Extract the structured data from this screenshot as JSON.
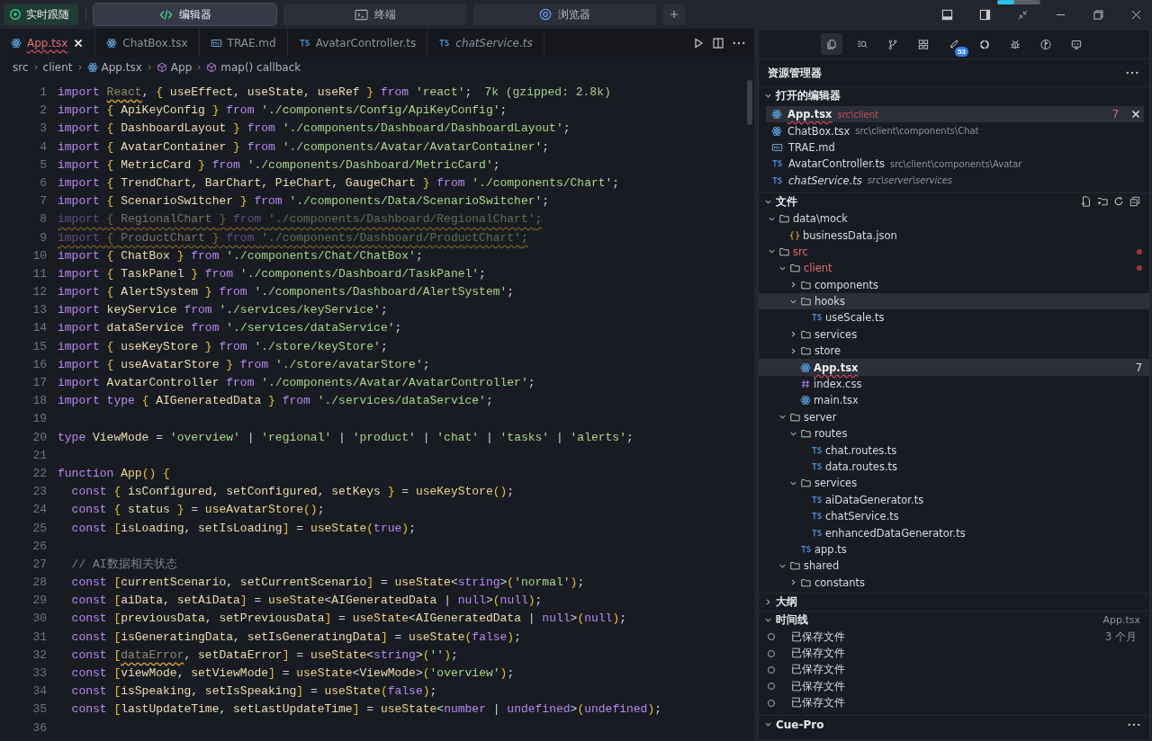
{
  "follow_button": {
    "label": "实时跟随"
  },
  "mode_tabs": [
    {
      "label": "编辑器",
      "kind": "code",
      "selected": true
    },
    {
      "label": "终端",
      "kind": "terminal",
      "selected": false
    },
    {
      "label": "浏览器",
      "kind": "compass",
      "selected": false
    }
  ],
  "top_progress": {
    "level": 0.4
  },
  "editor": {
    "tabs": [
      {
        "label": "App.tsx",
        "kind": "react",
        "selected": true,
        "error": true,
        "preview": false
      },
      {
        "label": "ChatBox.tsx",
        "kind": "react",
        "selected": false,
        "error": false,
        "preview": false
      },
      {
        "label": "TRAE.md",
        "kind": "md",
        "selected": false,
        "error": false,
        "preview": false
      },
      {
        "label": "AvatarController.ts",
        "kind": "ts",
        "selected": false,
        "error": false,
        "preview": false
      },
      {
        "label": "chatService.ts",
        "kind": "ts",
        "selected": false,
        "error": false,
        "preview": true
      }
    ],
    "breadcrumb": [
      {
        "label": "src",
        "kind": "folder"
      },
      {
        "label": "client",
        "kind": "folder"
      },
      {
        "label": "App.tsx",
        "kind": "react"
      },
      {
        "label": "App",
        "kind": "symbol"
      },
      {
        "label": "map() callback",
        "kind": "symbol"
      }
    ],
    "lines": [
      {
        "number": "1",
        "indented": false,
        "unused": false,
        "tokens": [
          {
            "kind": "keyword",
            "text": "import "
          },
          {
            "kind": "unused",
            "text": "React"
          },
          {
            "kind": "plain",
            "text": ", "
          },
          {
            "kind": "brace",
            "text": "{ "
          },
          {
            "kind": "name",
            "text": "useEffect, useState, useRef "
          },
          {
            "kind": "brace",
            "text": "}"
          },
          {
            "kind": "keyword",
            "text": " from "
          },
          {
            "kind": "string",
            "text": "'react'"
          },
          {
            "kind": "plain",
            "text": ";"
          }
        ],
        "hint": "7k (gzipped: 2.8k)"
      },
      {
        "number": "2",
        "indented": false,
        "unused": false,
        "tokens": [
          {
            "kind": "keyword",
            "text": "import "
          },
          {
            "kind": "brace",
            "text": "{ "
          },
          {
            "kind": "name",
            "text": "ApiKeyConfig "
          },
          {
            "kind": "brace",
            "text": "}"
          },
          {
            "kind": "keyword",
            "text": " from "
          },
          {
            "kind": "string",
            "text": "'./components/Config/ApiKeyConfig'"
          },
          {
            "kind": "plain",
            "text": ";"
          }
        ]
      },
      {
        "number": "3",
        "indented": false,
        "unused": false,
        "tokens": [
          {
            "kind": "keyword",
            "text": "import "
          },
          {
            "kind": "brace",
            "text": "{ "
          },
          {
            "kind": "name",
            "text": "DashboardLayout "
          },
          {
            "kind": "brace",
            "text": "}"
          },
          {
            "kind": "keyword",
            "text": " from "
          },
          {
            "kind": "string",
            "text": "'./components/Dashboard/DashboardLayout'"
          },
          {
            "kind": "plain",
            "text": ";"
          }
        ]
      },
      {
        "number": "4",
        "indented": false,
        "unused": false,
        "tokens": [
          {
            "kind": "keyword",
            "text": "import "
          },
          {
            "kind": "brace",
            "text": "{ "
          },
          {
            "kind": "name",
            "text": "AvatarContainer "
          },
          {
            "kind": "brace",
            "text": "}"
          },
          {
            "kind": "keyword",
            "text": " from "
          },
          {
            "kind": "string",
            "text": "'./components/Avatar/AvatarContainer'"
          },
          {
            "kind": "plain",
            "text": ";"
          }
        ]
      },
      {
        "number": "5",
        "indented": false,
        "unused": false,
        "tokens": [
          {
            "kind": "keyword",
            "text": "import "
          },
          {
            "kind": "brace",
            "text": "{ "
          },
          {
            "kind": "name",
            "text": "MetricCard "
          },
          {
            "kind": "brace",
            "text": "}"
          },
          {
            "kind": "keyword",
            "text": " from "
          },
          {
            "kind": "string",
            "text": "'./components/Dashboard/MetricCard'"
          },
          {
            "kind": "plain",
            "text": ";"
          }
        ]
      },
      {
        "number": "6",
        "indented": false,
        "unused": false,
        "tokens": [
          {
            "kind": "keyword",
            "text": "import "
          },
          {
            "kind": "brace",
            "text": "{ "
          },
          {
            "kind": "name",
            "text": "TrendChart, BarChart, PieChart, GaugeChart "
          },
          {
            "kind": "brace",
            "text": "}"
          },
          {
            "kind": "keyword",
            "text": " from "
          },
          {
            "kind": "string",
            "text": "'./components/Chart'"
          },
          {
            "kind": "plain",
            "text": ";"
          }
        ]
      },
      {
        "number": "7",
        "indented": false,
        "unused": false,
        "tokens": [
          {
            "kind": "keyword",
            "text": "import "
          },
          {
            "kind": "brace",
            "text": "{ "
          },
          {
            "kind": "name",
            "text": "ScenarioSwitcher "
          },
          {
            "kind": "brace",
            "text": "}"
          },
          {
            "kind": "keyword",
            "text": " from "
          },
          {
            "kind": "string",
            "text": "'./components/Data/ScenarioSwitcher'"
          },
          {
            "kind": "plain",
            "text": ";"
          }
        ]
      },
      {
        "number": "8",
        "indented": false,
        "unused": true,
        "tokens": [
          {
            "kind": "keyword",
            "text": "import "
          },
          {
            "kind": "brace",
            "text": "{ "
          },
          {
            "kind": "name",
            "text": "RegionalChart "
          },
          {
            "kind": "brace",
            "text": "}"
          },
          {
            "kind": "keyword",
            "text": " from "
          },
          {
            "kind": "string",
            "text": "'./components/Dashboard/RegionalChart'"
          },
          {
            "kind": "plain",
            "text": ";"
          }
        ]
      },
      {
        "number": "9",
        "indented": false,
        "unused": true,
        "tokens": [
          {
            "kind": "keyword",
            "text": "import "
          },
          {
            "kind": "brace",
            "text": "{ "
          },
          {
            "kind": "name",
            "text": "ProductChart "
          },
          {
            "kind": "brace",
            "text": "}"
          },
          {
            "kind": "keyword",
            "text": " from "
          },
          {
            "kind": "string",
            "text": "'./components/Dashboard/ProductChart'"
          },
          {
            "kind": "plain",
            "text": ";"
          }
        ]
      },
      {
        "number": "10",
        "indented": false,
        "unused": false,
        "tokens": [
          {
            "kind": "keyword",
            "text": "import "
          },
          {
            "kind": "brace",
            "text": "{ "
          },
          {
            "kind": "name",
            "text": "ChatBox "
          },
          {
            "kind": "brace",
            "text": "}"
          },
          {
            "kind": "keyword",
            "text": " from "
          },
          {
            "kind": "string",
            "text": "'./components/Chat/ChatBox'"
          },
          {
            "kind": "plain",
            "text": ";"
          }
        ]
      },
      {
        "number": "11",
        "indented": false,
        "unused": false,
        "tokens": [
          {
            "kind": "keyword",
            "text": "import "
          },
          {
            "kind": "brace",
            "text": "{ "
          },
          {
            "kind": "name",
            "text": "TaskPanel "
          },
          {
            "kind": "brace",
            "text": "}"
          },
          {
            "kind": "keyword",
            "text": " from "
          },
          {
            "kind": "string",
            "text": "'./components/Dashboard/TaskPanel'"
          },
          {
            "kind": "plain",
            "text": ";"
          }
        ]
      },
      {
        "number": "12",
        "indented": false,
        "unused": false,
        "tokens": [
          {
            "kind": "keyword",
            "text": "import "
          },
          {
            "kind": "brace",
            "text": "{ "
          },
          {
            "kind": "name",
            "text": "AlertSystem "
          },
          {
            "kind": "brace",
            "text": "}"
          },
          {
            "kind": "keyword",
            "text": " from "
          },
          {
            "kind": "string",
            "text": "'./components/Dashboard/AlertSystem'"
          },
          {
            "kind": "plain",
            "text": ";"
          }
        ]
      },
      {
        "number": "13",
        "indented": false,
        "unused": false,
        "tokens": [
          {
            "kind": "keyword",
            "text": "import "
          },
          {
            "kind": "name",
            "text": "keyService"
          },
          {
            "kind": "keyword",
            "text": " from "
          },
          {
            "kind": "string",
            "text": "'./services/keyService'"
          },
          {
            "kind": "plain",
            "text": ";"
          }
        ]
      },
      {
        "number": "14",
        "indented": false,
        "unused": false,
        "tokens": [
          {
            "kind": "keyword",
            "text": "import "
          },
          {
            "kind": "name",
            "text": "dataService"
          },
          {
            "kind": "keyword",
            "text": " from "
          },
          {
            "kind": "string",
            "text": "'./services/dataService'"
          },
          {
            "kind": "plain",
            "text": ";"
          }
        ]
      },
      {
        "number": "15",
        "indented": false,
        "unused": false,
        "tokens": [
          {
            "kind": "keyword",
            "text": "import "
          },
          {
            "kind": "brace",
            "text": "{ "
          },
          {
            "kind": "name",
            "text": "useKeyStore "
          },
          {
            "kind": "brace",
            "text": "}"
          },
          {
            "kind": "keyword",
            "text": " from "
          },
          {
            "kind": "string",
            "text": "'./store/keyStore'"
          },
          {
            "kind": "plain",
            "text": ";"
          }
        ]
      },
      {
        "number": "16",
        "indented": false,
        "unused": false,
        "tokens": [
          {
            "kind": "keyword",
            "text": "import "
          },
          {
            "kind": "brace",
            "text": "{ "
          },
          {
            "kind": "name",
            "text": "useAvatarStore "
          },
          {
            "kind": "brace",
            "text": "}"
          },
          {
            "kind": "keyword",
            "text": " from "
          },
          {
            "kind": "string",
            "text": "'./store/avatarStore'"
          },
          {
            "kind": "plain",
            "text": ";"
          }
        ]
      },
      {
        "number": "17",
        "indented": false,
        "unused": false,
        "tokens": [
          {
            "kind": "keyword",
            "text": "import "
          },
          {
            "kind": "name",
            "text": "AvatarController"
          },
          {
            "kind": "keyword",
            "text": " from "
          },
          {
            "kind": "string",
            "text": "'./components/Avatar/AvatarController'"
          },
          {
            "kind": "plain",
            "text": ";"
          }
        ]
      },
      {
        "number": "18",
        "indented": false,
        "unused": false,
        "tokens": [
          {
            "kind": "keyword",
            "text": "import type "
          },
          {
            "kind": "brace",
            "text": "{ "
          },
          {
            "kind": "name",
            "text": "AIGeneratedData "
          },
          {
            "kind": "brace",
            "text": "}"
          },
          {
            "kind": "keyword",
            "text": " from "
          },
          {
            "kind": "string",
            "text": "'./services/dataService'"
          },
          {
            "kind": "plain",
            "text": ";"
          }
        ]
      },
      {
        "number": "19"
      },
      {
        "number": "20",
        "indented": false,
        "unused": false,
        "tokens": [
          {
            "kind": "keyword",
            "text": "type "
          },
          {
            "kind": "name",
            "text": "ViewMode"
          },
          {
            "kind": "plain",
            "text": " = "
          },
          {
            "kind": "string",
            "text": "'overview'"
          },
          {
            "kind": "plain",
            "text": " | "
          },
          {
            "kind": "string",
            "text": "'regional'"
          },
          {
            "kind": "plain",
            "text": " | "
          },
          {
            "kind": "string",
            "text": "'product'"
          },
          {
            "kind": "plain",
            "text": " | "
          },
          {
            "kind": "string",
            "text": "'chat'"
          },
          {
            "kind": "plain",
            "text": " | "
          },
          {
            "kind": "string",
            "text": "'tasks'"
          },
          {
            "kind": "plain",
            "text": " | "
          },
          {
            "kind": "string",
            "text": "'alerts'"
          },
          {
            "kind": "plain",
            "text": ";"
          }
        ]
      },
      {
        "number": "21"
      },
      {
        "number": "22",
        "indented": false,
        "unused": false,
        "tokens": [
          {
            "kind": "keyword",
            "text": "function "
          },
          {
            "kind": "call",
            "text": "App"
          },
          {
            "kind": "brace",
            "text": "() {"
          }
        ]
      },
      {
        "number": "23",
        "indented": true,
        "unused": false,
        "tokens": [
          {
            "kind": "keyword",
            "text": "const "
          },
          {
            "kind": "brace",
            "text": "{ "
          },
          {
            "kind": "name",
            "text": "isConfigured, setConfigured, setKeys "
          },
          {
            "kind": "brace",
            "text": "}"
          },
          {
            "kind": "plain",
            "text": " = "
          },
          {
            "kind": "call",
            "text": "useKeyStore"
          },
          {
            "kind": "brace",
            "text": "()"
          },
          {
            "kind": "plain",
            "text": ";"
          }
        ]
      },
      {
        "number": "24",
        "indented": true,
        "unused": false,
        "tokens": [
          {
            "kind": "keyword",
            "text": "const "
          },
          {
            "kind": "brace",
            "text": "{ "
          },
          {
            "kind": "name",
            "text": "status "
          },
          {
            "kind": "brace",
            "text": "}"
          },
          {
            "kind": "plain",
            "text": " = "
          },
          {
            "kind": "call",
            "text": "useAvatarStore"
          },
          {
            "kind": "brace",
            "text": "()"
          },
          {
            "kind": "plain",
            "text": ";"
          }
        ]
      },
      {
        "number": "25",
        "indented": true,
        "unused": false,
        "tokens": [
          {
            "kind": "keyword",
            "text": "const "
          },
          {
            "kind": "brace",
            "text": "["
          },
          {
            "kind": "name",
            "text": "isLoading, setIsLoading"
          },
          {
            "kind": "brace",
            "text": "]"
          },
          {
            "kind": "plain",
            "text": " = "
          },
          {
            "kind": "call",
            "text": "useState"
          },
          {
            "kind": "brace",
            "text": "("
          },
          {
            "kind": "keyword",
            "text": "true"
          },
          {
            "kind": "brace",
            "text": ")"
          },
          {
            "kind": "plain",
            "text": ";"
          }
        ]
      },
      {
        "number": "26"
      },
      {
        "number": "27",
        "indented": true,
        "unused": false,
        "tokens": [
          {
            "kind": "comment",
            "text": "// AI数据相关状态"
          }
        ]
      },
      {
        "number": "28",
        "indented": true,
        "unused": false,
        "tokens": [
          {
            "kind": "keyword",
            "text": "const "
          },
          {
            "kind": "brace",
            "text": "["
          },
          {
            "kind": "name",
            "text": "currentScenario, setCurrentScenario"
          },
          {
            "kind": "brace",
            "text": "]"
          },
          {
            "kind": "plain",
            "text": " = "
          },
          {
            "kind": "call",
            "text": "useState"
          },
          {
            "kind": "plain",
            "text": "<"
          },
          {
            "kind": "keyword",
            "text": "string"
          },
          {
            "kind": "plain",
            "text": ">"
          },
          {
            "kind": "brace",
            "text": "("
          },
          {
            "kind": "string",
            "text": "'normal'"
          },
          {
            "kind": "brace",
            "text": ")"
          },
          {
            "kind": "plain",
            "text": ";"
          }
        ]
      },
      {
        "number": "29",
        "indented": true,
        "unused": false,
        "tokens": [
          {
            "kind": "keyword",
            "text": "const "
          },
          {
            "kind": "brace",
            "text": "["
          },
          {
            "kind": "name",
            "text": "aiData, setAiData"
          },
          {
            "kind": "brace",
            "text": "]"
          },
          {
            "kind": "plain",
            "text": " = "
          },
          {
            "kind": "call",
            "text": "useState"
          },
          {
            "kind": "plain",
            "text": "<"
          },
          {
            "kind": "name",
            "text": "AIGeneratedData"
          },
          {
            "kind": "plain",
            "text": " | "
          },
          {
            "kind": "keyword",
            "text": "null"
          },
          {
            "kind": "plain",
            "text": ">"
          },
          {
            "kind": "brace",
            "text": "("
          },
          {
            "kind": "keyword",
            "text": "null"
          },
          {
            "kind": "brace",
            "text": ")"
          },
          {
            "kind": "plain",
            "text": ";"
          }
        ]
      },
      {
        "number": "30",
        "indented": true,
        "unused": false,
        "tokens": [
          {
            "kind": "keyword",
            "text": "const "
          },
          {
            "kind": "brace",
            "text": "["
          },
          {
            "kind": "name",
            "text": "previousData, setPreviousData"
          },
          {
            "kind": "brace",
            "text": "]"
          },
          {
            "kind": "plain",
            "text": " = "
          },
          {
            "kind": "call",
            "text": "useState"
          },
          {
            "kind": "plain",
            "text": "<"
          },
          {
            "kind": "name",
            "text": "AIGeneratedData"
          },
          {
            "kind": "plain",
            "text": " | "
          },
          {
            "kind": "keyword",
            "text": "null"
          },
          {
            "kind": "plain",
            "text": ">"
          },
          {
            "kind": "brace",
            "text": "("
          },
          {
            "kind": "keyword",
            "text": "null"
          },
          {
            "kind": "brace",
            "text": ")"
          },
          {
            "kind": "plain",
            "text": ";"
          }
        ]
      },
      {
        "number": "31",
        "indented": true,
        "unused": false,
        "tokens": [
          {
            "kind": "keyword",
            "text": "const "
          },
          {
            "kind": "brace",
            "text": "["
          },
          {
            "kind": "name",
            "text": "isGeneratingData, setIsGeneratingData"
          },
          {
            "kind": "brace",
            "text": "]"
          },
          {
            "kind": "plain",
            "text": " = "
          },
          {
            "kind": "call",
            "text": "useState"
          },
          {
            "kind": "brace",
            "text": "("
          },
          {
            "kind": "keyword",
            "text": "false"
          },
          {
            "kind": "brace",
            "text": ")"
          },
          {
            "kind": "plain",
            "text": ";"
          }
        ]
      },
      {
        "number": "32",
        "indented": true,
        "unused": false,
        "tokens": [
          {
            "kind": "keyword",
            "text": "const "
          },
          {
            "kind": "brace",
            "text": "["
          },
          {
            "kind": "unused",
            "text": "dataError"
          },
          {
            "kind": "name",
            "text": ", setDataError"
          },
          {
            "kind": "brace",
            "text": "]"
          },
          {
            "kind": "plain",
            "text": " = "
          },
          {
            "kind": "call",
            "text": "useState"
          },
          {
            "kind": "plain",
            "text": "<"
          },
          {
            "kind": "keyword",
            "text": "string"
          },
          {
            "kind": "plain",
            "text": ">"
          },
          {
            "kind": "brace",
            "text": "("
          },
          {
            "kind": "string",
            "text": "''"
          },
          {
            "kind": "brace",
            "text": ")"
          },
          {
            "kind": "plain",
            "text": ";"
          }
        ]
      },
      {
        "number": "33",
        "indented": true,
        "unused": false,
        "tokens": [
          {
            "kind": "keyword",
            "text": "const "
          },
          {
            "kind": "brace",
            "text": "["
          },
          {
            "kind": "name",
            "text": "viewMode, setViewMode"
          },
          {
            "kind": "brace",
            "text": "]"
          },
          {
            "kind": "plain",
            "text": " = "
          },
          {
            "kind": "call",
            "text": "useState"
          },
          {
            "kind": "plain",
            "text": "<"
          },
          {
            "kind": "name",
            "text": "ViewMode"
          },
          {
            "kind": "plain",
            "text": ">"
          },
          {
            "kind": "brace",
            "text": "("
          },
          {
            "kind": "string",
            "text": "'overview'"
          },
          {
            "kind": "brace",
            "text": ")"
          },
          {
            "kind": "plain",
            "text": ";"
          }
        ]
      },
      {
        "number": "34",
        "indented": true,
        "unused": false,
        "tokens": [
          {
            "kind": "keyword",
            "text": "const "
          },
          {
            "kind": "brace",
            "text": "["
          },
          {
            "kind": "name",
            "text": "isSpeaking, setIsSpeaking"
          },
          {
            "kind": "brace",
            "text": "]"
          },
          {
            "kind": "plain",
            "text": " = "
          },
          {
            "kind": "call",
            "text": "useState"
          },
          {
            "kind": "brace",
            "text": "("
          },
          {
            "kind": "keyword",
            "text": "false"
          },
          {
            "kind": "brace",
            "text": ")"
          },
          {
            "kind": "plain",
            "text": ";"
          }
        ]
      },
      {
        "number": "35",
        "indented": true,
        "unused": false,
        "tokens": [
          {
            "kind": "keyword",
            "text": "const "
          },
          {
            "kind": "brace",
            "text": "["
          },
          {
            "kind": "name",
            "text": "lastUpdateTime, setLastUpdateTime"
          },
          {
            "kind": "brace",
            "text": "]"
          },
          {
            "kind": "plain",
            "text": " = "
          },
          {
            "kind": "call",
            "text": "useState"
          },
          {
            "kind": "plain",
            "text": "<"
          },
          {
            "kind": "keyword",
            "text": "number"
          },
          {
            "kind": "plain",
            "text": " | "
          },
          {
            "kind": "keyword",
            "text": "undefined"
          },
          {
            "kind": "plain",
            "text": ">"
          },
          {
            "kind": "brace",
            "text": "("
          },
          {
            "kind": "keyword",
            "text": "undefined"
          },
          {
            "kind": "brace",
            "text": ")"
          },
          {
            "kind": "plain",
            "text": ";"
          }
        ]
      },
      {
        "number": "36"
      }
    ]
  },
  "activity_bar": [
    {
      "kind": "files",
      "selected": true
    },
    {
      "kind": "search",
      "selected": false
    },
    {
      "kind": "branch",
      "selected": false
    },
    {
      "kind": "grid",
      "selected": false
    },
    {
      "kind": "rocket",
      "selected": false,
      "badge": "53"
    },
    {
      "kind": "ring",
      "selected": false
    },
    {
      "kind": "bug",
      "selected": false
    },
    {
      "kind": "flow",
      "selected": false
    },
    {
      "kind": "monitor",
      "selected": false
    }
  ],
  "explorer": {
    "title": "资源管理器",
    "open_editors": {
      "title": "打开的编辑器",
      "expanded": true,
      "items": [
        {
          "name": "App.tsx",
          "path": "src\\client",
          "kind": "react",
          "selected": true,
          "error": true,
          "preview": false,
          "count": "7"
        },
        {
          "name": "ChatBox.tsx",
          "path": "src\\client\\components\\Chat",
          "kind": "react",
          "selected": false,
          "error": false,
          "preview": false
        },
        {
          "name": "TRAE.md",
          "kind": "md",
          "selected": false,
          "error": false,
          "preview": false
        },
        {
          "name": "AvatarController.ts",
          "path": "src\\client\\components\\Avatar",
          "kind": "ts",
          "selected": false,
          "error": false,
          "preview": false
        },
        {
          "name": "chatService.ts",
          "path": "src\\server\\services",
          "kind": "ts",
          "selected": false,
          "error": false,
          "preview": true
        }
      ]
    },
    "files": {
      "title": "文件",
      "expanded": true,
      "tree": [
        {
          "name": "data\\mock",
          "kind": "folder",
          "expanded": true,
          "selected": false,
          "error": false,
          "children": [
            {
              "name": "businessData.json",
              "kind": "json",
              "selected": false,
              "error": false
            }
          ]
        },
        {
          "name": "src",
          "kind": "folder",
          "expanded": true,
          "selected": false,
          "error": true,
          "children": [
            {
              "name": "client",
              "kind": "folder",
              "expanded": true,
              "selected": false,
              "error": true,
              "children": [
                {
                  "name": "components",
                  "kind": "folder",
                  "expanded": false,
                  "selected": false,
                  "error": false
                },
                {
                  "name": "hooks",
                  "kind": "folder",
                  "expanded": true,
                  "selected": true,
                  "error": false,
                  "children": [
                    {
                      "name": "useScale.ts",
                      "kind": "ts",
                      "selected": false,
                      "error": false
                    }
                  ]
                },
                {
                  "name": "services",
                  "kind": "folder",
                  "expanded": false,
                  "selected": false,
                  "error": false
                },
                {
                  "name": "store",
                  "kind": "folder",
                  "expanded": false,
                  "selected": false,
                  "error": false
                },
                {
                  "name": "App.tsx",
                  "kind": "react",
                  "selected": true,
                  "error": true,
                  "count": "7"
                },
                {
                  "name": "index.css",
                  "kind": "css",
                  "selected": false,
                  "error": false
                },
                {
                  "name": "main.tsx",
                  "kind": "react",
                  "selected": false,
                  "error": false
                }
              ]
            },
            {
              "name": "server",
              "kind": "folder",
              "expanded": true,
              "selected": false,
              "error": false,
              "children": [
                {
                  "name": "routes",
                  "kind": "folder",
                  "expanded": true,
                  "selected": false,
                  "error": false,
                  "children": [
                    {
                      "name": "chat.routes.ts",
                      "kind": "ts",
                      "selected": false,
                      "error": false
                    },
                    {
                      "name": "data.routes.ts",
                      "kind": "ts",
                      "selected": false,
                      "error": false
                    }
                  ]
                },
                {
                  "name": "services",
                  "kind": "folder",
                  "expanded": true,
                  "selected": false,
                  "error": false,
                  "children": [
                    {
                      "name": "aiDataGenerator.ts",
                      "kind": "ts",
                      "selected": false,
                      "error": false
                    },
                    {
                      "name": "chatService.ts",
                      "kind": "ts",
                      "selected": false,
                      "error": false
                    },
                    {
                      "name": "enhancedDataGenerator.ts",
                      "kind": "ts",
                      "selected": false,
                      "error": false
                    }
                  ]
                },
                {
                  "name": "app.ts",
                  "kind": "ts",
                  "selected": false,
                  "error": false
                }
              ]
            },
            {
              "name": "shared",
              "kind": "folder",
              "expanded": true,
              "selected": false,
              "error": false,
              "children": [
                {
                  "name": "constants",
                  "kind": "folder",
                  "expanded": false,
                  "selected": false,
                  "error": false
                }
              ]
            }
          ]
        }
      ]
    },
    "outline": {
      "title": "大纲",
      "expanded": false
    },
    "timeline": {
      "title": "时间线",
      "expanded": true,
      "file": "App.tsx",
      "items": [
        {
          "label": "已保存文件",
          "time": "3 个月"
        },
        {
          "label": "已保存文件"
        },
        {
          "label": "已保存文件"
        },
        {
          "label": "已保存文件"
        },
        {
          "label": "已保存文件"
        }
      ]
    },
    "cue_pro": {
      "title": "Cue-Pro",
      "expanded": true
    }
  }
}
